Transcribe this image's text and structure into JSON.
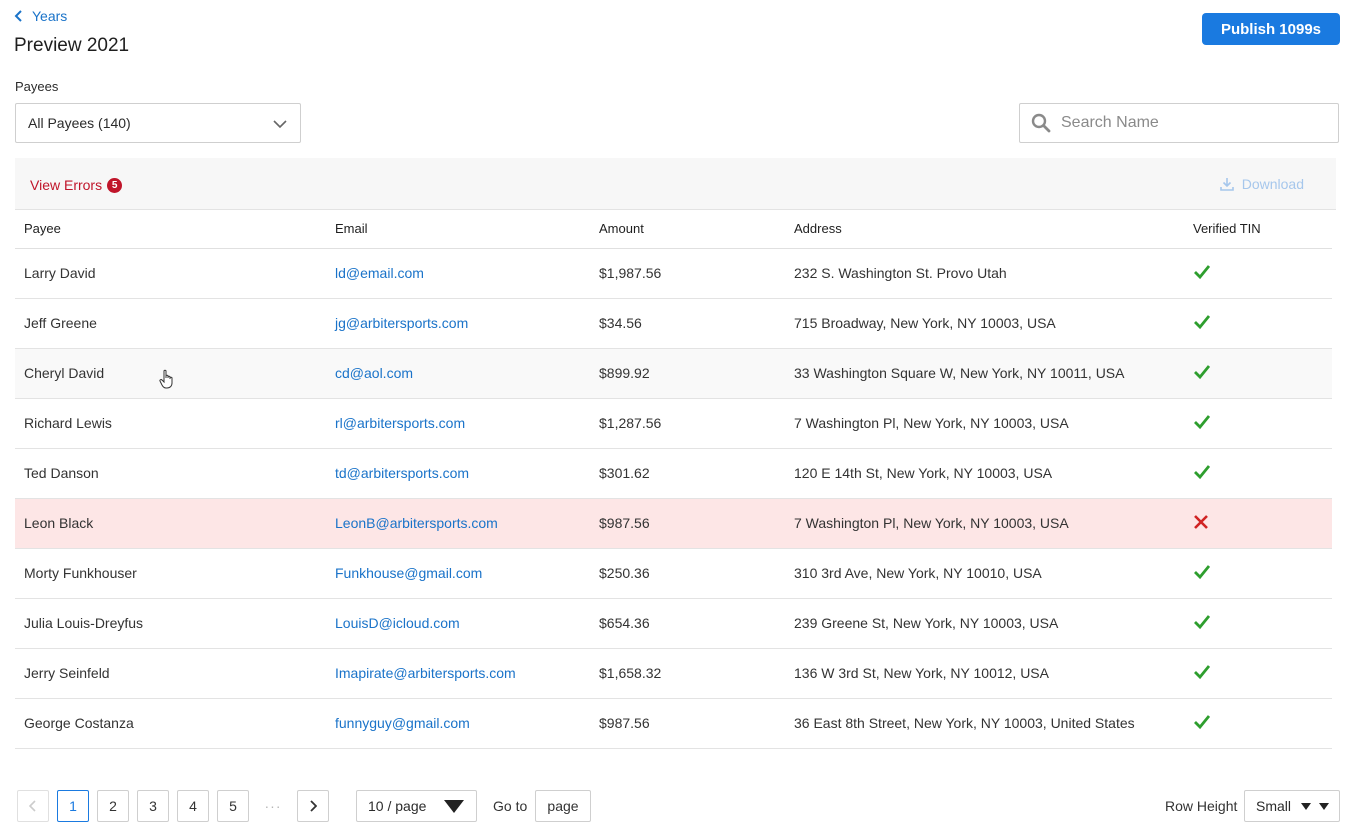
{
  "header": {
    "back_label": "Years",
    "title": "Preview 2021",
    "publish_label": "Publish 1099s"
  },
  "filters": {
    "payees_label": "Payees",
    "payees_selected": "All Payees (140)",
    "search_placeholder": "Search Name"
  },
  "toolbar": {
    "view_errors_label": "View Errors",
    "error_count": "5",
    "download_label": "Download"
  },
  "table": {
    "columns": [
      "Payee",
      "Email",
      "Amount",
      "Address",
      "Verified TIN"
    ],
    "rows": [
      {
        "payee": "Larry David",
        "email": "ld@email.com",
        "amount": "$1,987.56",
        "address": "232 S. Washington St. Provo Utah",
        "verified": true
      },
      {
        "payee": "Jeff Greene",
        "email": "jg@arbitersports.com",
        "amount": "$34.56",
        "address": "715 Broadway, New York, NY 10003, USA",
        "verified": true
      },
      {
        "payee": "Cheryl David",
        "email": "cd@aol.com",
        "amount": "$899.92",
        "address": "33 Washington Square W, New York, NY 10011, USA",
        "verified": true
      },
      {
        "payee": "Richard Lewis",
        "email": "rl@arbitersports.com",
        "amount": "$1,287.56",
        "address": "7 Washington Pl, New York, NY 10003, USA",
        "verified": true
      },
      {
        "payee": "Ted Danson",
        "email": "td@arbitersports.com",
        "amount": "$301.62",
        "address": "120 E 14th St, New York, NY 10003, USA",
        "verified": true
      },
      {
        "payee": "Leon Black",
        "email": "LeonB@arbitersports.com",
        "amount": "$987.56",
        "address": "7 Washington Pl, New York, NY 10003, USA",
        "verified": false
      },
      {
        "payee": "Morty Funkhouser",
        "email": "Funkhouse@gmail.com",
        "amount": "$250.36",
        "address": "310 3rd Ave, New York, NY 10010, USA",
        "verified": true
      },
      {
        "payee": "Julia Louis-Dreyfus",
        "email": "LouisD@icloud.com",
        "amount": "$654.36",
        "address": "239 Greene St, New York, NY 10003, USA",
        "verified": true
      },
      {
        "payee": "Jerry Seinfeld",
        "email": "Imapirate@arbitersports.com",
        "amount": "$1,658.32",
        "address": "136 W 3rd St, New York, NY 10012, USA",
        "verified": true
      },
      {
        "payee": "George Costanza",
        "email": "funnyguy@gmail.com",
        "amount": "$987.56",
        "address": "36 East 8th Street, New York, NY 10003, United States",
        "verified": true
      }
    ]
  },
  "pagination": {
    "pages": [
      "1",
      "2",
      "3",
      "4",
      "5"
    ],
    "current_page": "1",
    "ellipsis": "···",
    "per_page": "10 / page",
    "goto_label": "Go to",
    "goto_placeholder": "page",
    "row_height_label": "Row Height",
    "row_height_value": "Small"
  },
  "colors": {
    "accent": "#1a7ae0",
    "link": "#1a73c9",
    "error": "#c0152a",
    "success": "#2e9e2e",
    "error_row_bg": "#fde6e6"
  }
}
